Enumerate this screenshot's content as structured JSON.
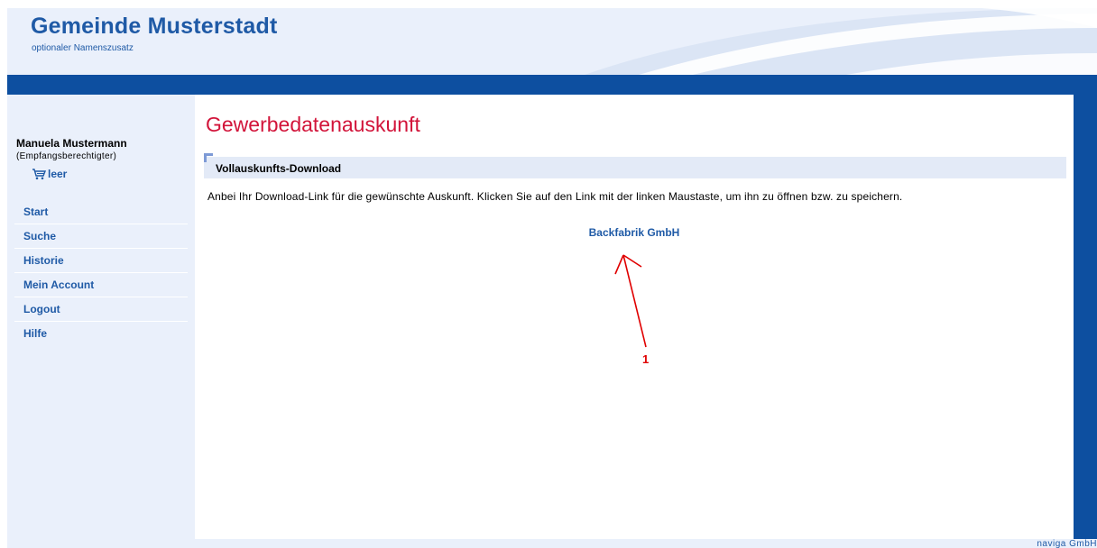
{
  "header": {
    "title": "Gemeinde Musterstadt",
    "subtitle": "optionaler Namenszusatz"
  },
  "sidebar": {
    "user_name": "Manuela Mustermann",
    "user_role": "(Empfangsberechtigter)",
    "cart_label": "leer",
    "cart_icon": "cart-icon",
    "items": [
      {
        "label": "Start"
      },
      {
        "label": "Suche"
      },
      {
        "label": "Historie"
      },
      {
        "label": "Mein Account"
      },
      {
        "label": "Logout"
      },
      {
        "label": "Hilfe"
      }
    ]
  },
  "main": {
    "page_title": "Gewerbedatenauskunft",
    "section_title": "Vollauskunfts-Download",
    "info_text": "Anbei Ihr Download-Link für die gewünschte Auskunft. Klicken Sie auf den Link mit der linken Maustaste, um ihn zu öffnen bzw. zu speichern.",
    "download_link": "Backfabrik GmbH",
    "annotation_label": "1"
  },
  "footer": {
    "credit": "naviga GmbH"
  },
  "colors": {
    "brand_blue": "#0d4fa0",
    "link_blue": "#1f5aa6",
    "title_red": "#d2143a",
    "annotation_red": "#e00000",
    "background": "#eaf0fb"
  }
}
